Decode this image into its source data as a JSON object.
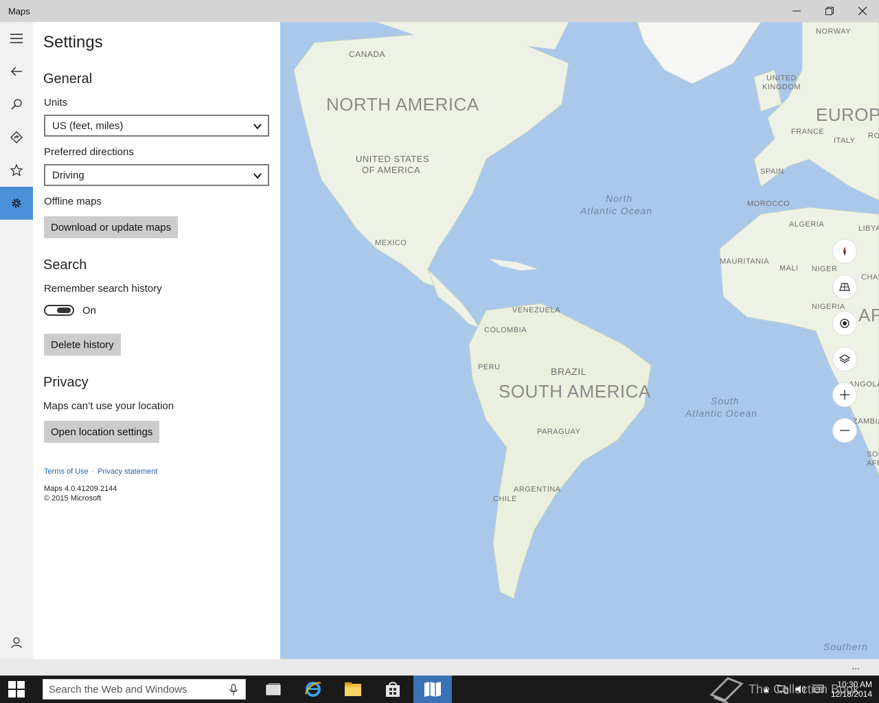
{
  "window": {
    "title": "Maps"
  },
  "rail": {
    "items": [
      {
        "name": "menu"
      },
      {
        "name": "back"
      },
      {
        "name": "search"
      },
      {
        "name": "directions"
      },
      {
        "name": "favorites"
      },
      {
        "name": "settings"
      }
    ],
    "active_color": "#4a90d9"
  },
  "settings": {
    "title": "Settings",
    "general": {
      "heading": "General",
      "units_label": "Units",
      "units_value": "US (feet, miles)",
      "directions_label": "Preferred directions",
      "directions_value": "Driving",
      "offline_label": "Offline maps",
      "download_button": "Download or update maps"
    },
    "search": {
      "heading": "Search",
      "remember_label": "Remember search history",
      "toggle_state": "On",
      "delete_button": "Delete history"
    },
    "privacy": {
      "heading": "Privacy",
      "location_text": "Maps can’t use your location",
      "open_button": "Open location settings"
    },
    "links": {
      "terms": "Terms of Use",
      "separator": "·",
      "privacy": "Privacy statement"
    },
    "version": "Maps 4.0.41209.2144",
    "copyright": "© 2015 Microsoft"
  },
  "map": {
    "labels": {
      "canada": "CANADA",
      "north_america": "NORTH AMERICA",
      "usa_1": "UNITED STATES",
      "usa_2": "OF AMERICA",
      "mexico": "MEXICO",
      "venezuela": "VENEZUELA",
      "colombia": "COLOMBIA",
      "peru": "PERU",
      "brazil": "BRAZIL",
      "south_america": "SOUTH AMERICA",
      "paraguay": "PARAGUAY",
      "argentina": "ARGENTINA",
      "chile": "CHILE",
      "norway": "NORWAY",
      "uk_1": "UNITED",
      "uk_2": "KINGDOM",
      "europe": "EUROPE",
      "france": "FRANCE",
      "italy": "ITALY",
      "spain": "SPAIN",
      "rome": "ROM",
      "morocco": "MOROCCO",
      "algeria": "ALGERIA",
      "libya": "LIBYA",
      "mauritania": "MAURITANIA",
      "mali": "MALI",
      "niger": "NIGER",
      "chad": "CHAD",
      "nigeria": "NIGERIA",
      "africa": "AFR",
      "angola": "ANGOLA",
      "zambia": "ZAMBIA",
      "south_af": "SOU",
      "afr2": "AFR",
      "north_atlantic_1": "North",
      "north_atlantic_2": "Atlantic Ocean",
      "south_atlantic_1": "South",
      "south_atlantic_2": "Atlantic Ocean",
      "southern": "Southern"
    },
    "controls": [
      "compass",
      "tilt",
      "my-location",
      "layers",
      "zoom-in",
      "zoom-out"
    ]
  },
  "taskbar": {
    "search_placeholder": "Search the Web and Windows",
    "apps": [
      "task-view",
      "internet-explorer",
      "file-explorer",
      "store",
      "maps"
    ],
    "time": "10:30 AM",
    "date": "12/18/2014"
  },
  "watermark": "The Collection Book"
}
